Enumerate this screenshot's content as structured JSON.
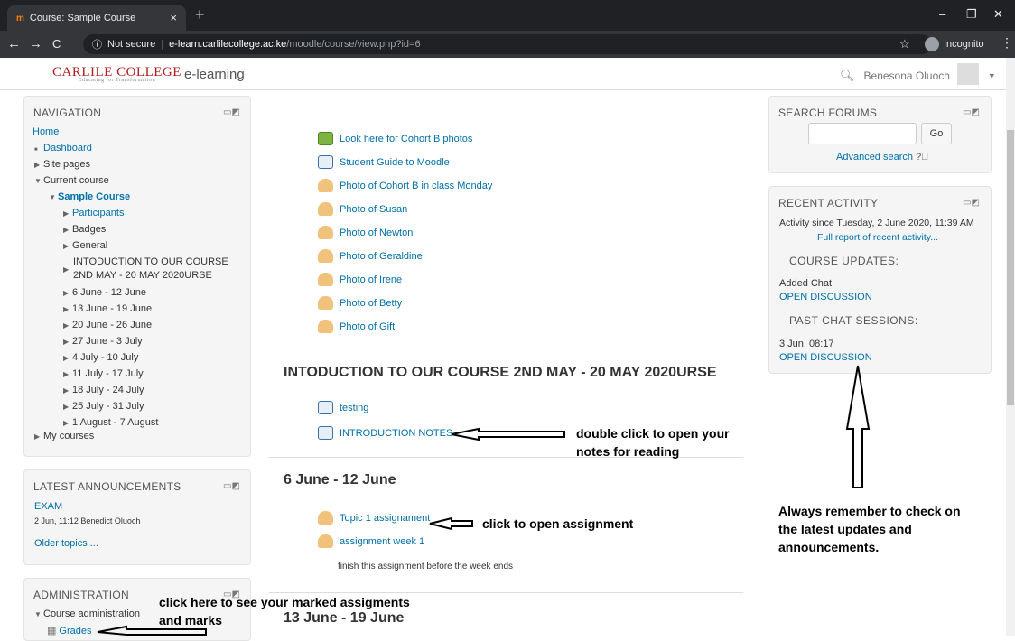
{
  "browser": {
    "tab_title": "Course: Sample Course",
    "favicon": "m",
    "url_secure": "Not secure",
    "url_host": "e-learn.carlilecollege.ac.ke",
    "url_path": "/moodle/course/view.php?id=6",
    "incognito": "Incognito"
  },
  "header": {
    "logo": "CARLILE COLLEGE",
    "logo_tagline": "Educating for Transformation",
    "site_name": "e-learning",
    "user_name": "Benesona Oluoch"
  },
  "navigation": {
    "title": "NAVIGATION",
    "home": "Home",
    "dashboard": "Dashboard",
    "site_pages": "Site pages",
    "current_course": "Current course",
    "course": "Sample Course",
    "participants": "Participants",
    "badges": "Badges",
    "general": "General",
    "intro1": "INTODUCTION TO OUR COURSE",
    "intro2": "2ND MAY - 20 MAY 2020URSE",
    "weeks": [
      "6 June - 12 June",
      "13 June - 19 June",
      "20 June - 26 June",
      "27 June - 3 July",
      "4 July - 10 July",
      "11 July - 17 July",
      "18 July - 24 July",
      "25 July - 31 July",
      "1 August - 7 August"
    ],
    "my_courses": "My courses"
  },
  "announcements": {
    "title": "LATEST ANNOUNCEMENTS",
    "item": "EXAM",
    "meta": "2 Jun, 11:12 Benedict Oluoch",
    "older": "Older topics ..."
  },
  "admin": {
    "title": "ADMINISTRATION",
    "course_admin": "Course administration",
    "grades": "Grades"
  },
  "main": {
    "resources": [
      "Look here for Cohort B photos",
      "Student Guide to Moodle",
      "Photo of Cohort B in class Monday",
      "Photo of Susan",
      "Photo of Newton",
      "Photo of Geraldine",
      "Photo of Irene",
      "Photo of Betty",
      "Photo of Gift"
    ],
    "section1_title": "INTODUCTION TO OUR COURSE 2ND MAY - 20 MAY 2020URSE",
    "section1_items": [
      "testing",
      "INTRODUCTION NOTES"
    ],
    "section2_title": "6 June - 12 June",
    "section2_items": [
      "Topic 1 assignament",
      "assignment week 1"
    ],
    "section2_note": "finish this assignment before the week ends",
    "section3_title": "13 June - 19 June"
  },
  "search_forums": {
    "title": "SEARCH FORUMS",
    "go": "Go",
    "advanced": "Advanced search"
  },
  "recent": {
    "title": "RECENT ACTIVITY",
    "since": "Activity since Tuesday, 2 June 2020, 11:39 AM",
    "full_report": "Full report of recent activity...",
    "course_updates": "COURSE UPDATES:",
    "added": "Added Chat",
    "open1": "OPEN DISCUSSION",
    "past_chat": "PAST CHAT SESSIONS:",
    "session_time": "3 Jun, 08:17",
    "open2": "OPEN DISCUSSION"
  },
  "annotations": {
    "notes1": "double click to open your",
    "notes2": "notes for reading",
    "assign": "click to open assignment",
    "marks1": "click here to see your marked assigments",
    "marks2": "and marks",
    "updates1": "Always remember to check on",
    "updates2": "the latest updates and",
    "updates3": "announcements."
  }
}
